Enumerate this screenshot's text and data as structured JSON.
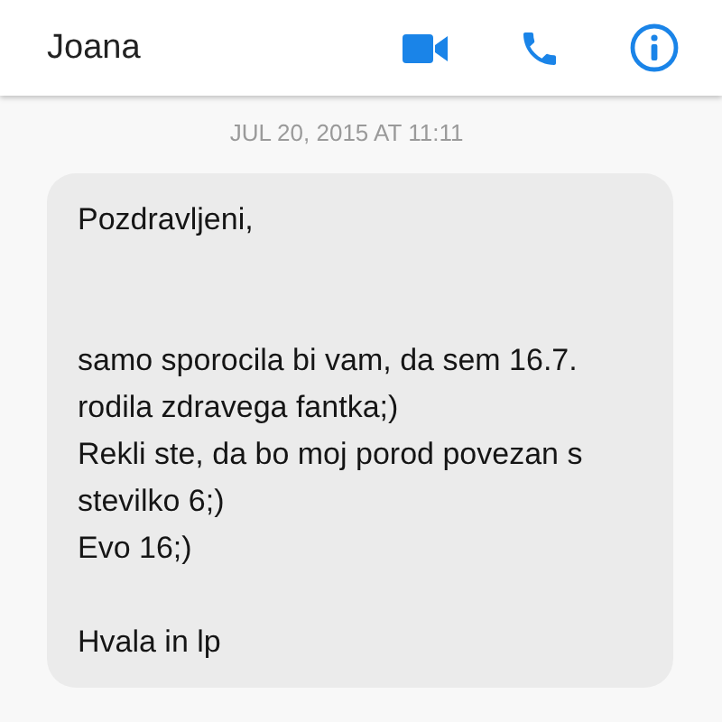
{
  "header": {
    "contact_name": "Joana"
  },
  "timestamp": "JUL 20, 2015 AT 11:11",
  "messages": [
    {
      "kind": "incoming",
      "text": "Pozdravljeni,\n\n\nsamo sporocila bi vam, da sem 16.7. rodila zdravega fantka;)\nRekli ste, da bo moj porod povezan s stevilko 6;)\nEvo 16;)\n\nHvala in lp"
    }
  ]
}
